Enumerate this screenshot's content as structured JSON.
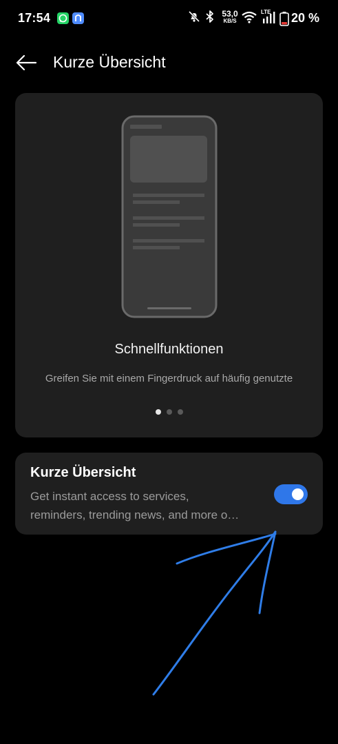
{
  "status_bar": {
    "time": "17:54",
    "network_speed_value": "53,0",
    "network_speed_unit": "KB/S",
    "network_type": "LTE",
    "battery": "20 %",
    "icons": [
      "whatsapp-icon",
      "app-notification-icon",
      "mute-icon",
      "bluetooth-icon",
      "wifi-icon",
      "signal-icon",
      "battery-icon"
    ]
  },
  "header": {
    "title": "Kurze Übersicht",
    "back_icon": "arrow-left-icon"
  },
  "preview": {
    "feature_title": "Schnellfunktionen",
    "feature_description": "Greifen Sie mit einem Fingerdruck auf häufig genutzte",
    "pagination": {
      "total": 3,
      "active": 1
    }
  },
  "setting": {
    "title": "Kurze Übersicht",
    "description_line1": "Get instant access to services,",
    "description_line2": "reminders, trending news, and more o…",
    "enabled": true
  },
  "colors": {
    "accent": "#2f77e9",
    "card_background": "#1f1f1f",
    "annotation": "#2f7de8"
  }
}
